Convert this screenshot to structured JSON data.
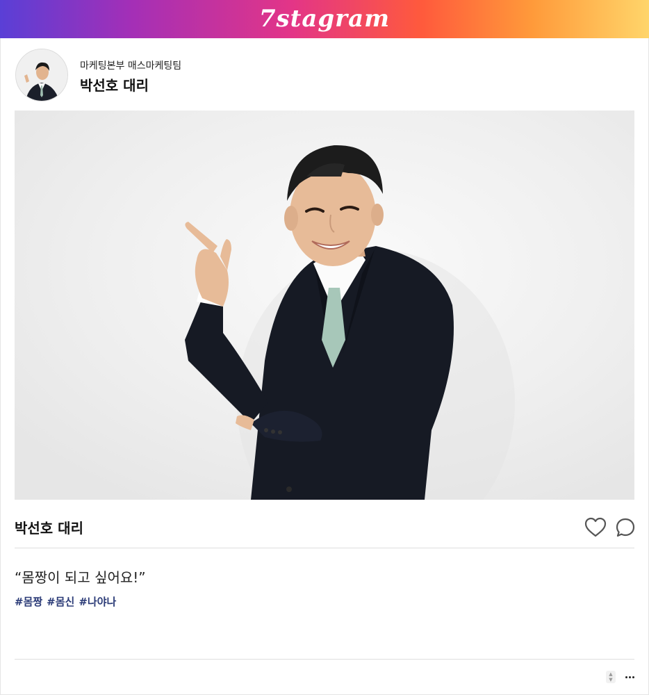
{
  "brand": {
    "name": "7stagram"
  },
  "profile": {
    "department": "마케팅본부 매스마케팅팀",
    "name": "박선호 대리"
  },
  "post": {
    "author_name": "박선호 대리",
    "quote": "“몸짱이 되고 싶어요!”",
    "hashtags": [
      "#몸짱",
      "#몸신",
      "#나야나"
    ]
  },
  "icons": {
    "like": "heart-icon",
    "comment": "comment-bubble-icon",
    "more": "more-dots-icon",
    "stepper": "up-down-stepper-icon"
  },
  "colors": {
    "hashtag": "#2c3c78",
    "divider": "#dedede"
  }
}
